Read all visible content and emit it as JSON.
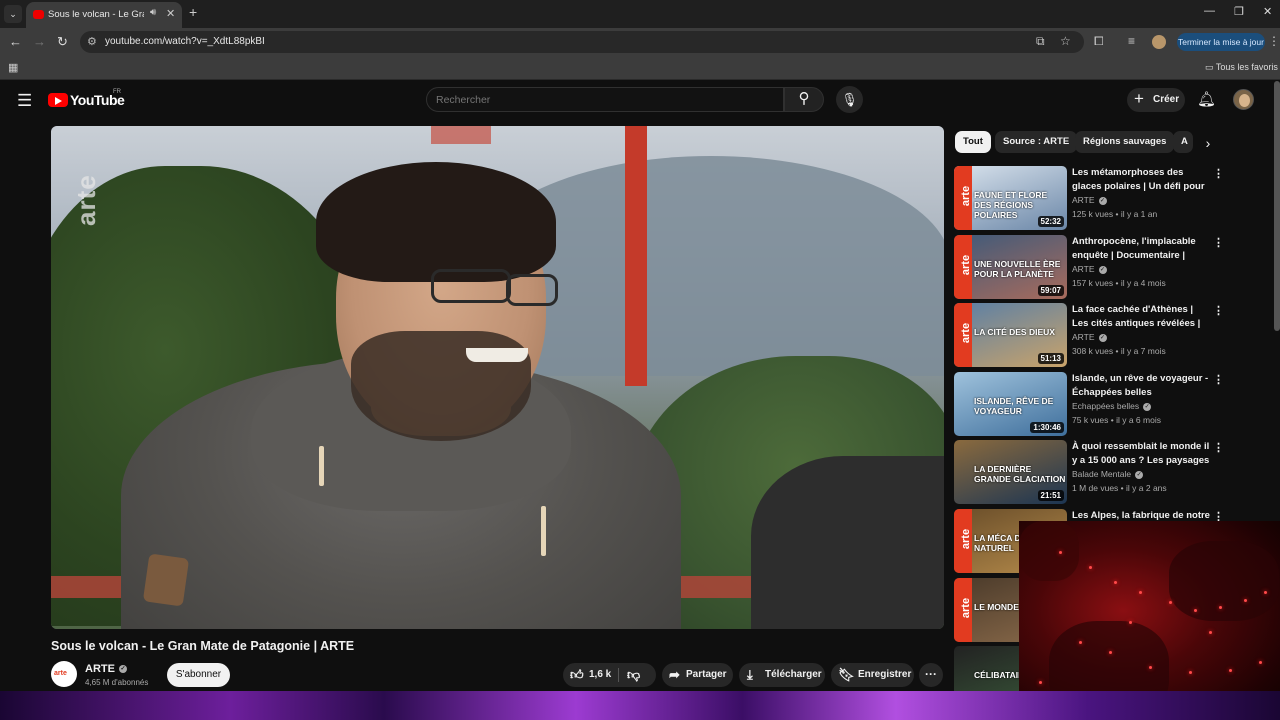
{
  "browser": {
    "tab_title": "Sous le volcan - Le Gran Mate de Patagonie | ARTE",
    "url": "youtube.com/watch?v=_XdtL88pkBI",
    "update_button": "Terminer la mise à jour",
    "bookmarks_folder": "Tous les favoris"
  },
  "header": {
    "logo_text": "YouTube",
    "region": "FR",
    "search_placeholder": "Rechercher",
    "create_label": "Créer"
  },
  "player": {
    "watermark": "arte"
  },
  "video": {
    "title": "Sous le volcan - Le Gran Mate de Patagonie | ARTE",
    "channel_avatar_text": "arte",
    "channel_name": "ARTE",
    "subscribers": "4,65 M d'abonnés",
    "subscribe_label": "S'abonner",
    "likes": "1,6 k",
    "share_label": "Partager",
    "download_label": "Télécharger",
    "save_label": "Enregistrer"
  },
  "chips": [
    "Tout",
    "Source : ARTE",
    "Régions sauvages",
    "A"
  ],
  "recommendations": [
    {
      "title": "Les métamorphoses des glaces polaires | Un défi pour les ...",
      "channel": "ARTE",
      "views": "125 k vues",
      "age": "il y a 1 an",
      "duration": "52:32",
      "overlay": "FAUNE ET FLORE DES RÉGIONS POLAIRES",
      "brand": "arte",
      "color_a": "#6b87a8",
      "color_b": "#d8e2ec"
    },
    {
      "title": "Anthropocène, l'implacable enquête | Documentaire | ARTE",
      "channel": "ARTE",
      "views": "157 k vues",
      "age": "il y a 4 mois",
      "duration": "59:07",
      "overlay": "UNE NOUVELLE ÈRE POUR LA PLANÈTE",
      "brand": "arte",
      "color_a": "#a86b5c",
      "color_b": "#3f5a7a"
    },
    {
      "title": "La face cachée d'Athènes | Les cités antiques révélées | ARTE",
      "channel": "ARTE",
      "views": "308 k vues",
      "age": "il y a 7 mois",
      "duration": "51:13",
      "overlay": "LA CITÉ DES DIEUX",
      "brand": "arte",
      "color_a": "#c9a36a",
      "color_b": "#5a7fa6"
    },
    {
      "title": "Islande, un rêve de voyageur - Échappées belles",
      "channel": "Echappées belles",
      "views": "75 k vues",
      "age": "il y a 6 mois",
      "duration": "1:30:46",
      "overlay": "ISLANDE, RÊVE DE VOYAGEUR",
      "brand": "",
      "color_a": "#3f6f9c",
      "color_b": "#9fc2dc"
    },
    {
      "title": "À quoi ressemblait le monde il y a 15 000 ans ? Les paysages ...",
      "channel": "Balade Mentale",
      "views": "1 M de vues",
      "age": "il y a 2 ans",
      "duration": "21:51",
      "overlay": "LA DERNIÈRE GRANDE GLACIATION",
      "brand": "",
      "color_a": "#1c3552",
      "color_b": "#8a6a3e"
    },
    {
      "title": "Les Alpes, la fabrique de notre",
      "channel": "",
      "views": "",
      "age": "",
      "duration": "",
      "overlay": "LA MÉCA DES FORC NATUREL",
      "brand": "arte",
      "color_a": "#b48a4a",
      "color_b": "#6a4e2a"
    },
    {
      "title": "",
      "channel": "",
      "views": "",
      "age": "",
      "duration": "",
      "overlay": "LE MONDE DES RATS",
      "brand": "arte",
      "color_a": "#8a6a4a",
      "color_b": "#4a3a2a"
    },
    {
      "title": "",
      "channel": "",
      "views": "",
      "age": "",
      "duration": "",
      "overlay": "CÉLIBATAIR",
      "brand": "",
      "color_a": "#3a5a3a",
      "color_b": "#222"
    }
  ]
}
